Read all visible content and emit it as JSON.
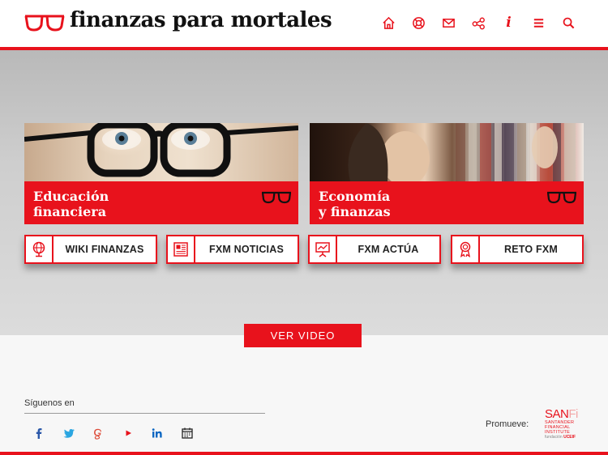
{
  "header": {
    "logo_text": "finanzas para mortales",
    "nav": [
      {
        "name": "home-icon"
      },
      {
        "name": "lifebuoy-icon"
      },
      {
        "name": "mail-icon"
      },
      {
        "name": "share-icon"
      },
      {
        "name": "info-icon",
        "glyph": "i"
      },
      {
        "name": "menu-icon"
      },
      {
        "name": "search-icon"
      }
    ]
  },
  "cards": [
    {
      "title_line1": "Educación",
      "title_line2": "financiera"
    },
    {
      "title_line1": "Economía",
      "title_line2": "y finanzas"
    }
  ],
  "tiles": [
    {
      "label": "WIKI FINANZAS",
      "icon": "globe-icon"
    },
    {
      "label": "FXM NOTICIAS",
      "icon": "newspaper-icon"
    },
    {
      "label": "FXM ACTÚA",
      "icon": "presentation-icon"
    },
    {
      "label": "RETO FXM",
      "icon": "award-icon"
    }
  ],
  "video_button": "VER VIDEO",
  "footer": {
    "follow_label": "Síguenos en",
    "social": [
      "facebook-icon",
      "twitter-icon",
      "google-plus-icon",
      "youtube-icon",
      "linkedin-icon",
      "calendar-icon"
    ],
    "promote_label": "Promueve:",
    "sanfi": {
      "main": "SAN",
      "fi": "Fi",
      "sub1": "SANTANDER",
      "sub2": "FINANCIAL",
      "sub3": "INSTITUTE",
      "tag_prefix": "fundación",
      "tag_brand": "UCEIF"
    }
  },
  "colors": {
    "accent": "#e8121c"
  }
}
